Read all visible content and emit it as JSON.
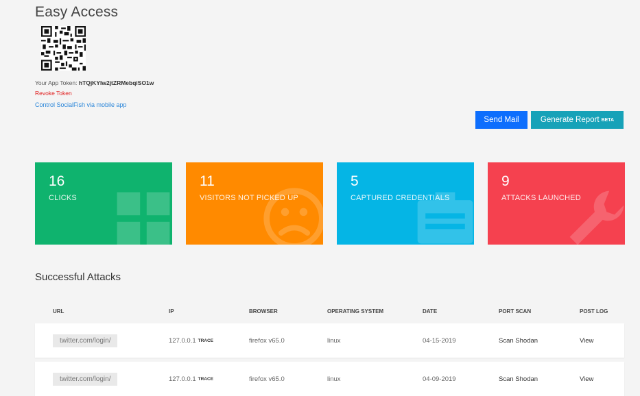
{
  "header": {
    "title": "Easy Access",
    "token_label": "Your App Token:",
    "token_value": "hTQjKYIw2jtZRMebqiSO1w",
    "revoke_label": "Revoke Token",
    "control_link": "Control SocialFish via mobile app"
  },
  "actions": {
    "send_mail": "Send Mail",
    "generate_report": "Generate Report",
    "beta_badge": "BETA"
  },
  "stats": [
    {
      "value": "16",
      "label": "CLICKS",
      "color": "#0fb36e",
      "icon": "grid-icon"
    },
    {
      "value": "11",
      "label": "VISITORS NOT PICKED UP",
      "color": "#ff8a00",
      "icon": "sad-face-icon"
    },
    {
      "value": "5",
      "label": "CAPTURED CREDENTIALS",
      "color": "#05b5e5",
      "icon": "id-card-icon"
    },
    {
      "value": "9",
      "label": "ATTACKS LAUNCHED",
      "color": "#f5414f",
      "icon": "wrench-icon"
    }
  ],
  "attacks": {
    "title": "Successful Attacks",
    "columns": [
      "URL",
      "IP",
      "BROWSER",
      "OPERATING SYSTEM",
      "DATE",
      "PORT SCAN",
      "POST LOG"
    ],
    "rows": [
      {
        "url": "twitter.com/login/",
        "ip": "127.0.0.1",
        "trace": "TRACE",
        "browser": "firefox v65.0",
        "os": "linux",
        "date": "04-15-2019",
        "port_scan": "Scan Shodan",
        "post_log": "View"
      },
      {
        "url": "twitter.com/login/",
        "ip": "127.0.0.1",
        "trace": "TRACE",
        "browser": "firefox v65.0",
        "os": "linux",
        "date": "04-09-2019",
        "port_scan": "Scan Shodan",
        "post_log": "View"
      }
    ]
  }
}
